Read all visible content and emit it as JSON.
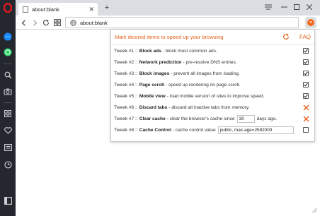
{
  "window": {
    "tab_title": "about:blank",
    "url": "about:blank"
  },
  "sidebar": {
    "items": [
      "opera-logo-icon",
      "messenger-icon",
      "whatsapp-icon",
      "search-icon",
      "camera-icon",
      "speed-dial-icon",
      "heart-icon",
      "news-icon",
      "history-icon",
      "sidebar-toggle-icon"
    ]
  },
  "popup": {
    "title": "Mark desired items to speed up your browsing",
    "faq": "FAQ",
    "tweaks": [
      {
        "prefix": "Tweek #1 ::",
        "name": "Block ads",
        "desc": "- block most common ads.",
        "state": "checked"
      },
      {
        "prefix": "Tweek #2 ::",
        "name": "Network prediction",
        "desc": "- pre-resolve DNS entries.",
        "state": "checked"
      },
      {
        "prefix": "Tweek #3 ::",
        "name": "Block images",
        "desc": "- prevent all images from loading.",
        "state": "checked"
      },
      {
        "prefix": "Tweek #4 ::",
        "name": "Page scroll",
        "desc": "- speed up rendering on page scroll.",
        "state": "checked"
      },
      {
        "prefix": "Tweek #5 ::",
        "name": "Mobile view",
        "desc": "- load mobile version of sites to improve speed.",
        "state": "checked"
      },
      {
        "prefix": "Tweek #6 ::",
        "name": "Discard tabs",
        "desc": "- discard all inactive tabs from memory.",
        "state": "disabled"
      },
      {
        "prefix": "Tweek #7 ::",
        "name": "Clear cache",
        "desc": "- clear the browser's cache since",
        "input": "30",
        "suffix": "days ago.",
        "state": "disabled"
      },
      {
        "prefix": "Tweek #8 ::",
        "name": "Cache Control",
        "desc": "- cache control value",
        "input": "public, max-age=2592000",
        "state": "unchecked"
      }
    ]
  },
  "colors": {
    "accent": "#e5621c",
    "sidebar_bg": "#24272e",
    "opera_red": "#e01a22",
    "messenger_blue": "#1a8cff",
    "whatsapp_green": "#25d366"
  }
}
